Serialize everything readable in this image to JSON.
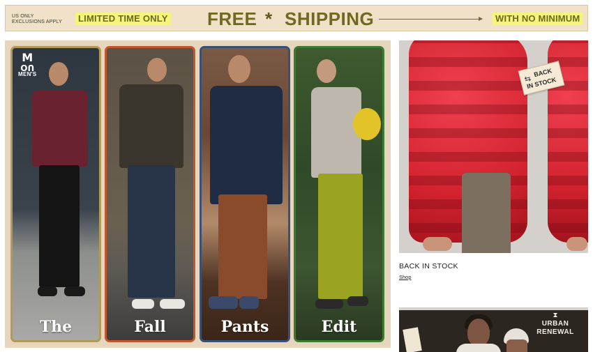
{
  "banner": {
    "small_line1": "US ONLY",
    "small_line2": "EXCLUSIONS APPLY",
    "left_highlight": "LIMITED TIME ONLY",
    "headline_word1": "FREE",
    "headline_separator": "*",
    "headline_word2": "SHIPPING",
    "right_highlight": "WITH NO MINIMUM",
    "colors": {
      "background": "#efe2c8",
      "highlight": "#f4f57a",
      "text": "#6f6a1f"
    }
  },
  "hero": {
    "logo": {
      "mark": "M",
      "mark2": "UO",
      "label": "MEN'S"
    },
    "captions": [
      "The",
      "Fall",
      "Pants",
      "Edit"
    ],
    "border_colors": [
      "#b29a5a",
      "#c2562f",
      "#3a5074",
      "#3f7a33"
    ]
  },
  "side_card": {
    "stamp_icon": "refresh-icon",
    "stamp_line1": "BACK",
    "stamp_line2": "IN STOCK",
    "title": "BACK IN STOCK",
    "link": "Shop"
  },
  "second_card": {
    "brand_icon": "⧗",
    "brand_label": "URBAN RENEWAL"
  }
}
